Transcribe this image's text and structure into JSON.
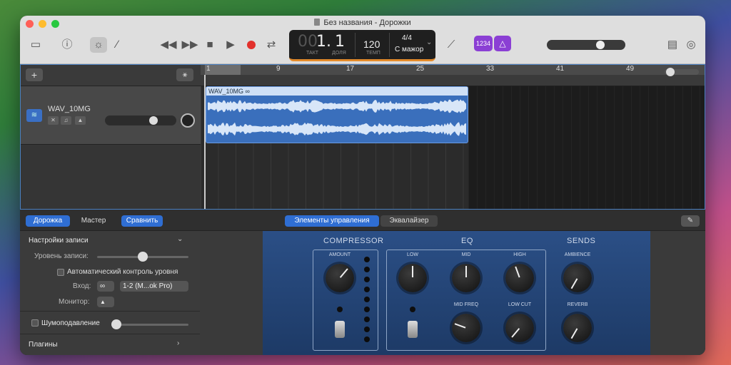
{
  "window": {
    "title": "Без названия - Дорожки"
  },
  "lcd": {
    "bar_prefix": "00",
    "bar": "1.",
    "beat": "1",
    "bar_label": "ТАКТ",
    "beat_label": "ДОЛЯ",
    "tempo": "120",
    "tempo_label": "ТЕМП",
    "signature": "4/4",
    "key": "С мажор"
  },
  "badges": {
    "count_in": "1234"
  },
  "tracks_header": {
    "add_label": "+"
  },
  "ruler": {
    "marks": [
      "1",
      "9",
      "17",
      "25",
      "33",
      "41",
      "49"
    ]
  },
  "track": {
    "name": "WAV_10MG",
    "region_name": "WAV_10MG"
  },
  "bottom": {
    "tabs_left": [
      "Дорожка",
      "Мастер"
    ],
    "compare": "Сравнить",
    "tabs_center": [
      "Элементы управления",
      "Эквалайзер"
    ]
  },
  "recording": {
    "title": "Настройки записи",
    "level_label": "Уровень записи:",
    "auto_level": "Автоматический контроль уровня",
    "input_label": "Вход:",
    "input_value": "1-2  (M...ok Pro)",
    "monitor_label": "Монитор:",
    "noise_gate": "Шумоподавление",
    "plugins": "Плагины"
  },
  "plugin": {
    "sections": [
      "COMPRESSOR",
      "EQ",
      "SENDS"
    ],
    "knobs": {
      "amount": "AMOUNT",
      "low": "LOW",
      "mid": "MID",
      "high": "HIGH",
      "mid_freq": "MID FREQ",
      "low_cut": "LOW CUT",
      "ambience": "AMBIENCE",
      "reverb": "REVERB"
    }
  },
  "colors": {
    "accent": "#2f6ed3",
    "region": "#3a6fbc",
    "record": "#e2312c",
    "badge": "#8b3fd4"
  },
  "levels": {
    "master_volume": 0.7,
    "track_volume": 0.7,
    "record_level": 0.5,
    "zoom": 0.05
  }
}
